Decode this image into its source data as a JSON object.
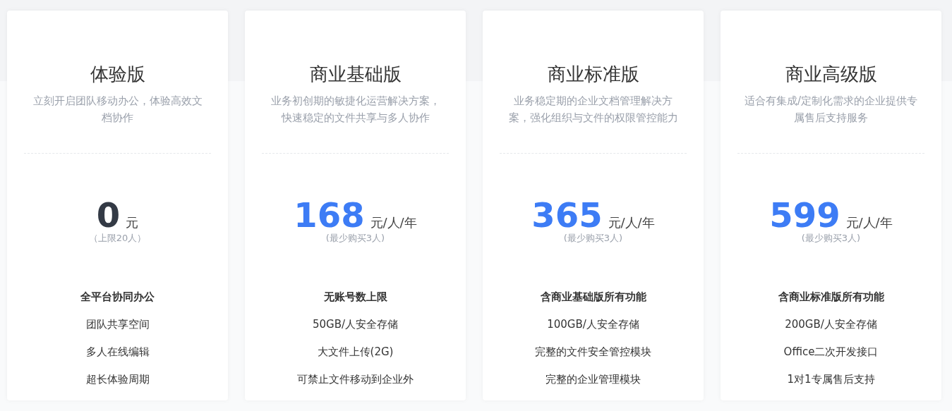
{
  "plans": [
    {
      "name": "体验版",
      "description": "立刻开启团队移动办公，体验高效文档协作",
      "price": "0",
      "unit": "元",
      "note": "（上限20人）",
      "highlighted": false,
      "features": [
        "全平台协同办公",
        "团队共享空间",
        "多人在线编辑",
        "超长体验周期"
      ]
    },
    {
      "name": "商业基础版",
      "description": "业务初创期的敏捷化运营解决方案，快速稳定的文件共享与多人协作",
      "price": "168",
      "unit": "元/人/年",
      "note": "(最少购买3人)",
      "highlighted": true,
      "features": [
        "无账号数上限",
        "50GB/人安全存储",
        "大文件上传(2G)",
        "可禁止文件移动到企业外"
      ]
    },
    {
      "name": "商业标准版",
      "description": "业务稳定期的企业文档管理解决方案，强化组织与文件的权限管控能力",
      "price": "365",
      "unit": "元/人/年",
      "note": "(最少购买3人)",
      "highlighted": true,
      "features": [
        "含商业基础版所有功能",
        "100GB/人安全存储",
        "完整的文件安全管控模块",
        "完整的企业管理模块"
      ]
    },
    {
      "name": "商业高级版",
      "description": "适合有集成/定制化需求的企业提供专属售后支持服务",
      "price": "599",
      "unit": "元/人/年",
      "note": "(最少购买3人)",
      "highlighted": true,
      "features": [
        "含商业标准版所有功能",
        "200GB/人安全存储",
        "Office二次开发接口",
        "1对1专属售后支持"
      ]
    }
  ]
}
